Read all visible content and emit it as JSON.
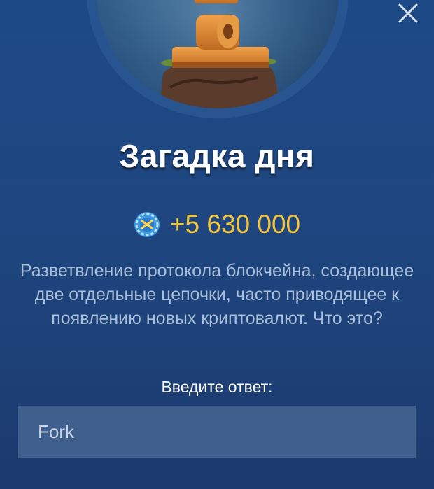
{
  "header": {
    "close_icon": "close-icon"
  },
  "hero": {
    "image": "puzzle-illustration"
  },
  "title": "Загадка дня",
  "reward": {
    "icon": "coin-icon",
    "amount": "+5 630 000",
    "color": "#f3c53a"
  },
  "question": "Разветвление протокола блокчейна, создающее две отдельные цепочки, часто приводящее к появлению новых криптовалют. Что это?",
  "answer": {
    "label": "Введите ответ:",
    "value": "Fork"
  },
  "colors": {
    "background": "#1f4680",
    "input": "#3f5f8c",
    "question_text": "#a9bfd9"
  }
}
